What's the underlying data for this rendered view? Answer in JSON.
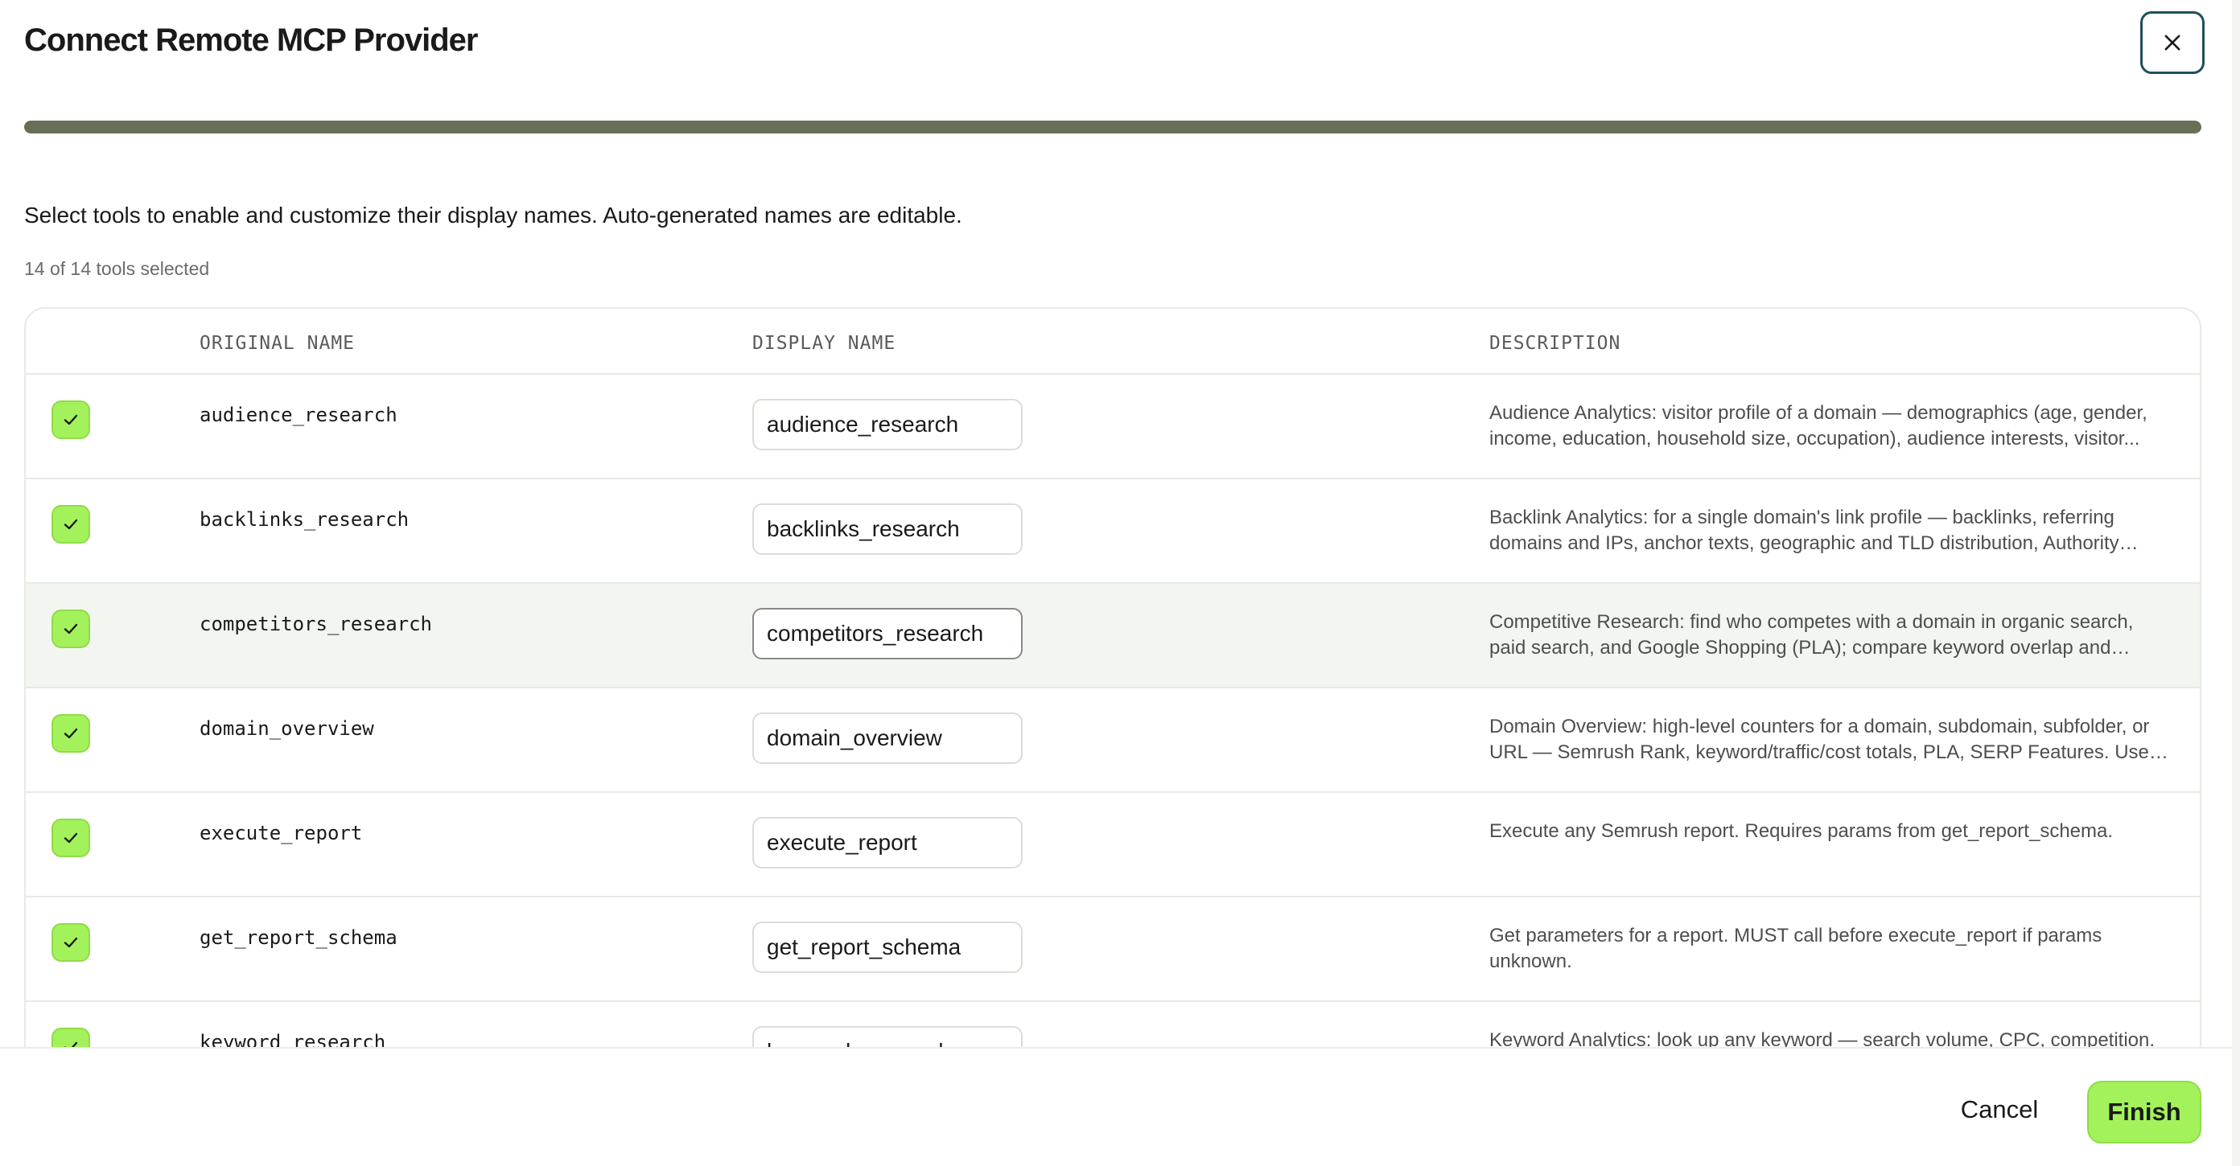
{
  "dialog": {
    "title": "Connect Remote MCP Provider",
    "progress_percent": 100,
    "instructions": "Select tools to enable and customize their display names. Auto-generated names are editable.",
    "selected_count": "14 of 14 tools selected"
  },
  "table": {
    "headers": {
      "original": "ORIGINAL NAME",
      "display": "DISPLAY NAME",
      "description": "DESCRIPTION"
    },
    "rows": [
      {
        "original": "audience_research",
        "display": "audience_research",
        "description": "Audience Analytics: visitor profile of a domain — demographics (age, gender, income, education, household size, occupation), audience interests, visitor...",
        "checked": true
      },
      {
        "original": "backlinks_research",
        "display": "backlinks_research",
        "description": "Backlink Analytics: for a single domain's link profile — backlinks, referring domains and IPs, anchor texts, geographic and TLD distribution, Authority Score breakdow...",
        "checked": true
      },
      {
        "original": "competitors_research",
        "display": "competitors_research",
        "description": "Competitive Research: find who competes with a domain in organic search, paid search, and Google Shopping (PLA); compare keyword overlap and backlink...",
        "checked": true
      },
      {
        "original": "domain_overview",
        "display": "domain_overview",
        "description": "Domain Overview: high-level counters for a domain, subdomain, subfolder, or URL — Semrush Rank, keyword/traffic/cost totals, PLA, SERP Features. Use-if: rank,...",
        "checked": true
      },
      {
        "original": "execute_report",
        "display": "execute_report",
        "description": "Execute any Semrush report. Requires params from get_report_schema.",
        "checked": true
      },
      {
        "original": "get_report_schema",
        "display": "get_report_schema",
        "description": "Get parameters for a report. MUST call before execute_report if params unknown.",
        "checked": true
      },
      {
        "original": "keyword_research",
        "display": "keyword_research",
        "description": "Keyword Analytics: look up any keyword — search volume, CPC, competition.",
        "checked": true
      }
    ]
  },
  "footer": {
    "cancel_label": "Cancel",
    "finish_label": "Finish"
  },
  "colors": {
    "accent_green": "#a3f25c",
    "progress_fill": "#667057",
    "close_border": "#1f4f5c"
  },
  "icons": {
    "close": "close-icon",
    "check": "checkmark-icon"
  }
}
